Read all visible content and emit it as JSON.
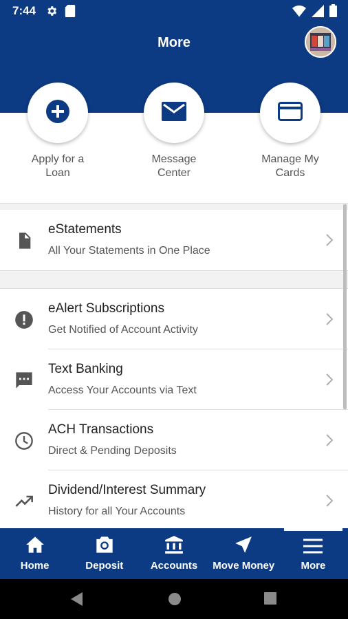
{
  "status_bar": {
    "time": "7:44"
  },
  "header": {
    "title": "More"
  },
  "quick_actions": [
    {
      "label": "Apply for a\nLoan",
      "icon": "plus-circle-icon"
    },
    {
      "label": "Message\nCenter",
      "icon": "mail-icon"
    },
    {
      "label": "Manage My\nCards",
      "icon": "credit-card-icon"
    }
  ],
  "menu": [
    {
      "title": "eStatements",
      "subtitle": "All Your Statements in One Place",
      "icon": "document-icon"
    },
    {
      "title": "eAlert Subscriptions",
      "subtitle": "Get Notified of Account Activity",
      "icon": "alert-icon"
    },
    {
      "title": "Text Banking",
      "subtitle": "Access Your Accounts via Text",
      "icon": "chat-icon"
    },
    {
      "title": "ACH Transactions",
      "subtitle": "Direct & Pending Deposits",
      "icon": "clock-icon"
    },
    {
      "title": "Dividend/Interest Summary",
      "subtitle": "History for all Your Accounts",
      "icon": "trending-up-icon"
    }
  ],
  "bottom_nav": [
    {
      "label": "Home",
      "icon": "home-icon"
    },
    {
      "label": "Deposit",
      "icon": "camera-icon"
    },
    {
      "label": "Accounts",
      "icon": "bank-icon"
    },
    {
      "label": "Move Money",
      "icon": "navigation-arrow-icon"
    },
    {
      "label": "More",
      "icon": "menu-icon",
      "active": true
    }
  ],
  "colors": {
    "brand": "#0c3a83",
    "icon_gray": "#555555",
    "divider": "#dcdcdc"
  }
}
